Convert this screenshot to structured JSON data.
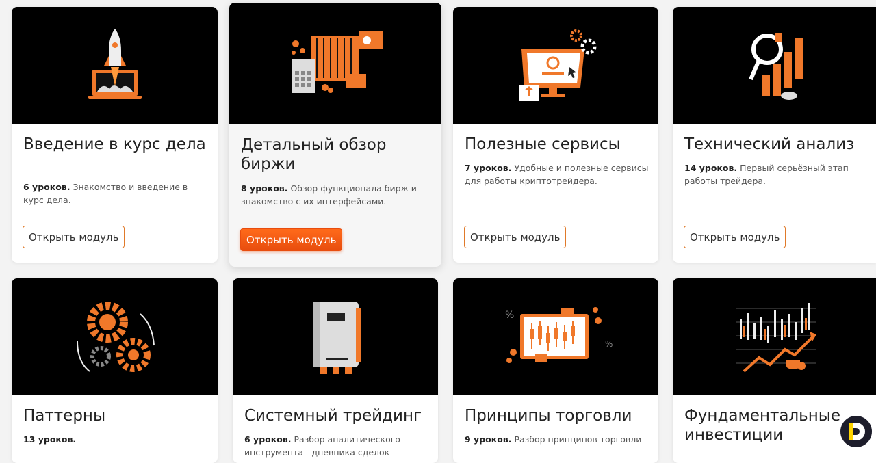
{
  "modules": [
    {
      "title": "Введение в курс дела",
      "lessons": "6 уроков.",
      "desc": "Знакомство и введение в курс дела.",
      "button": "Открыть модуль",
      "icon": "rocket-laptop-icon"
    },
    {
      "title": "Детальный обзор биржи",
      "lessons": "8 уроков.",
      "desc": "Обзор функционала бирж и знакомство с их интерфейсами.",
      "button": "Открыть модуль",
      "icon": "exchange-dashboard-icon"
    },
    {
      "title": "Полезные сервисы",
      "lessons": "7 уроков.",
      "desc": "Удобные и полезные сервисы для работы криптотрейдера.",
      "button": "Открыть модуль",
      "icon": "monitor-gears-icon"
    },
    {
      "title": "Технический анализ",
      "lessons": "14 уроков.",
      "desc": "Первый серьёзный этап работы трейдера.",
      "button": "Открыть модуль",
      "icon": "magnifier-bars-icon"
    },
    {
      "title": "Паттерны",
      "lessons": "13 уроков.",
      "desc": "",
      "icon": "gears-cycle-icon"
    },
    {
      "title": "Системный трейдинг",
      "lessons": "6 уроков.",
      "desc": "Разбор аналитического инструмента - дневника сделок",
      "icon": "trading-journal-icon"
    },
    {
      "title": "Принципы торговли",
      "lessons": "9 уроков.",
      "desc": "Разбор принципов торговли",
      "icon": "candlestick-board-icon"
    },
    {
      "title": "Фундаментальные инвестиции",
      "lessons": "",
      "desc": "",
      "icon": "growth-chart-coins-icon"
    }
  ],
  "colors": {
    "accent": "#f0782a",
    "button_primary": "#ff5a14"
  }
}
